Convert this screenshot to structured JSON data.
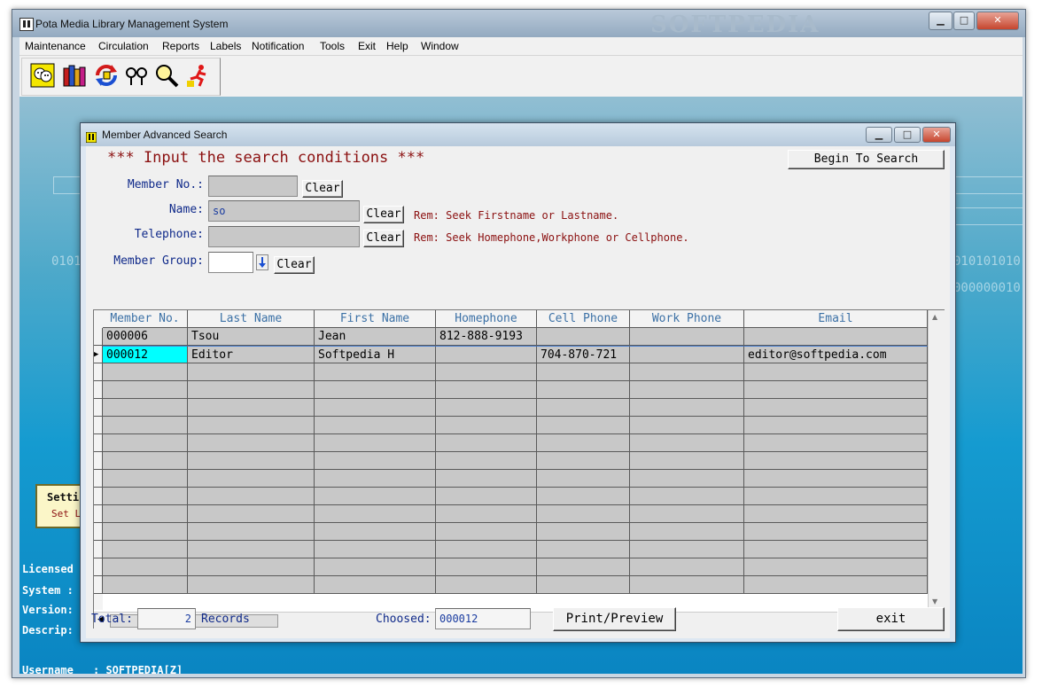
{
  "app": {
    "title": "Pota Media Library Management System",
    "watermark": "SOFTPEDIA",
    "menu": [
      "Maintenance",
      "Circulation",
      "Reports",
      "Labels",
      "Notification",
      "Tools",
      "Exit",
      "Help",
      "Window"
    ],
    "toolbar_icons": [
      "member-icon",
      "books-icon",
      "circulation-arrows-icon",
      "glasses-icon",
      "search-magnifier-icon",
      "exit-runner-icon"
    ]
  },
  "desktop": {
    "settings_label": "Setti",
    "settings_sub": "Set Li",
    "licensed": "Licensed",
    "system": "System :",
    "version": "Version:",
    "description": "Descrip:",
    "username_label": "Username",
    "username_value": ": SOFTPEDIA[Z]"
  },
  "dialog": {
    "title": "Member Advanced Search",
    "heading": "*** Input the search conditions ***",
    "begin_button": "Begin To Search",
    "fields": {
      "member_no": {
        "label": "Member No.:",
        "value": "",
        "clear": "Clear"
      },
      "name": {
        "label": "Name:",
        "value": "so",
        "clear": "Clear",
        "rem": "Rem: Seek Firstname or Lastname."
      },
      "telephone": {
        "label": "Telephone:",
        "value": "",
        "clear": "Clear",
        "rem": "Rem: Seek Homephone,Workphone or Cellphone."
      },
      "member_group": {
        "label": "Member Group:",
        "value": "",
        "clear": "Clear"
      }
    },
    "grid": {
      "columns": [
        "Member No.",
        "Last Name",
        "First Name",
        "Homephone",
        "Cell Phone",
        "Work Phone",
        "Email"
      ],
      "rows": [
        [
          "000006",
          "Tsou",
          "Jean",
          "812-888-9193",
          "",
          "",
          ""
        ],
        [
          "000012",
          "Editor",
          "Softpedia H",
          "",
          "704-870-721",
          "",
          "editor@softpedia.com"
        ]
      ],
      "selected_row": 1
    },
    "footer": {
      "total_label": "Total:",
      "total_value": "2",
      "records_label": "Records",
      "choosed_label": "Choosed:",
      "choosed_value": "000012",
      "print_button": "Print/Preview",
      "exit_button": "exit"
    }
  },
  "colors": {
    "label_blue": "#102a8a",
    "heading_red": "#8b1010",
    "header_text": "#3c71a6",
    "selected_cell": "#00ffff"
  }
}
